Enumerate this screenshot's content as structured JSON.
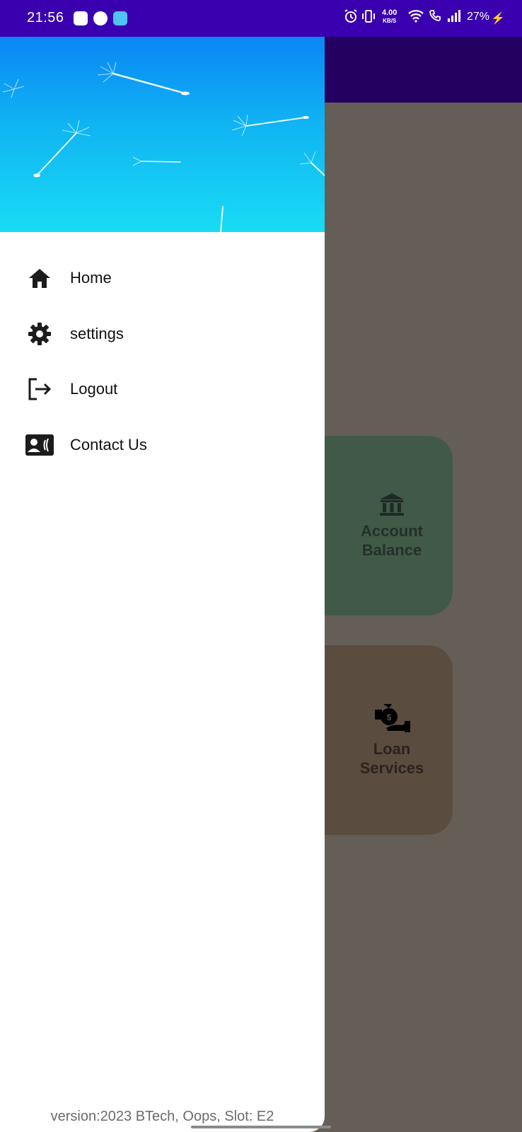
{
  "status_bar": {
    "time": "21:56",
    "speed_value": "4.00",
    "speed_unit": "KB/S",
    "battery": "27%"
  },
  "drawer": {
    "menu": [
      {
        "label": "Home",
        "icon": "home-icon"
      },
      {
        "label": "settings",
        "icon": "gear-icon"
      },
      {
        "label": "Logout",
        "icon": "logout-icon"
      },
      {
        "label": "Contact Us",
        "icon": "contact-card-icon"
      }
    ],
    "version_text": "version:2023 BTech, Oops, Slot: E2"
  },
  "background_app": {
    "cards": [
      {
        "line1": "Account",
        "line2": "Balance",
        "icon": "bank-icon",
        "color": "#415a47"
      },
      {
        "line1": "Loan",
        "line2": "Services",
        "icon": "money-hand-icon",
        "color": "#5b4c40"
      }
    ]
  },
  "colors": {
    "status_bar": "#3a00b0",
    "app_bar": "#240060",
    "scrim_background": "#645e57",
    "drawer_header_top": "#0a86f5",
    "drawer_header_bottom": "#19dcf4"
  }
}
